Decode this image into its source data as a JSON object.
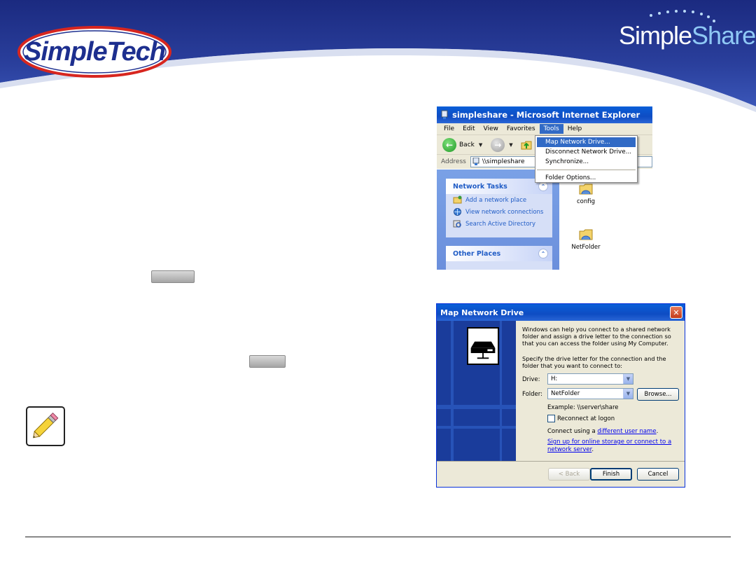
{
  "branding": {
    "left_logo": "SimpleTech",
    "right_logo_part1": "Simple",
    "right_logo_part2": "Share"
  },
  "ie_window": {
    "title": "simpleshare - Microsoft Internet Explorer",
    "menu": [
      "File",
      "Edit",
      "View",
      "Favorites",
      "Tools",
      "Help"
    ],
    "back_label": "Back",
    "address_label": "Address",
    "address_value": "\\\\simpleshare",
    "tools_menu": {
      "map_network_drive": "Map Network Drive...",
      "disconnect_network_drive": "Disconnect Network Drive...",
      "synchronize": "Synchronize...",
      "folder_options": "Folder Options..."
    },
    "network_tasks": {
      "heading": "Network Tasks",
      "items": [
        "Add a network place",
        "View network connections",
        "Search Active Directory"
      ]
    },
    "other_places": {
      "heading": "Other Places"
    },
    "folders": [
      "config",
      "NetFolder"
    ]
  },
  "map_dialog": {
    "title": "Map Network Drive",
    "intro": "Windows can help you connect to a shared network folder and assign a drive letter to the connection so that you can access the folder using My Computer.",
    "instruction": "Specify the drive letter for the connection and the folder that you want to connect to:",
    "drive_label": "Drive:",
    "drive_value": "H:",
    "folder_label": "Folder:",
    "folder_value": "NetFolder",
    "browse_label": "Browse...",
    "example": "Example: \\\\server\\share",
    "reconnect_label": "Reconnect at logon",
    "connect_prefix": "Connect using a ",
    "connect_link": "different user name",
    "connect_suffix": ".",
    "signup_link": "Sign up for online storage or connect to a network server",
    "signup_suffix": ".",
    "back_button": "< Back",
    "finish_button": "Finish",
    "cancel_button": "Cancel"
  }
}
